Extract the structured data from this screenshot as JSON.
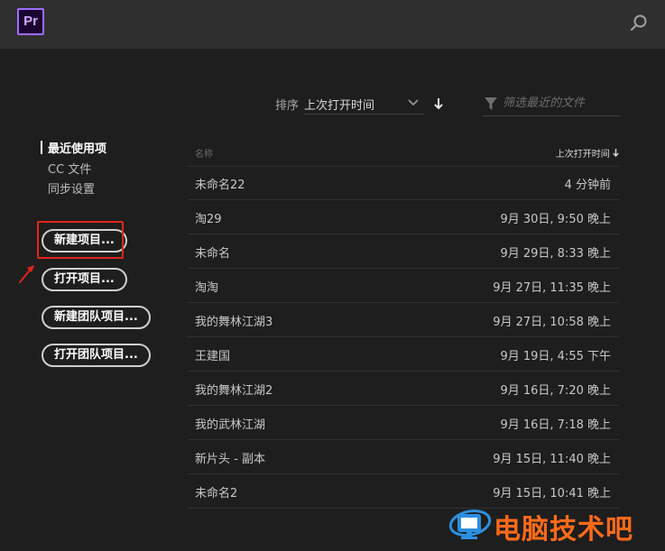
{
  "app": {
    "logo": "Pr"
  },
  "toolbar": {
    "sort_label": "排序",
    "sort_value": "上次打开时间",
    "filter_placeholder": "筛选最近的文件"
  },
  "nav": {
    "items": [
      {
        "label": "最近使用项",
        "active": true
      },
      {
        "label": "CC 文件"
      },
      {
        "label": "同步设置"
      }
    ]
  },
  "buttons": {
    "new_project": "新建项目...",
    "open_project": "打开项目...",
    "new_team_project": "新建团队项目...",
    "open_team_project": "打开团队项目..."
  },
  "table": {
    "col_name": "名称",
    "col_date": "上次打开时间",
    "rows": [
      {
        "name": "未命名22",
        "date": "4 分钟前"
      },
      {
        "name": "淘29",
        "date": "9月 30日, 9:50 晚上"
      },
      {
        "name": "未命名",
        "date": "9月 29日, 8:33 晚上"
      },
      {
        "name": "淘淘",
        "date": "9月 27日, 11:35 晚上"
      },
      {
        "name": "我的舞林江湖3",
        "date": "9月 27日, 10:58 晚上"
      },
      {
        "name": "王建国",
        "date": "9月 19日, 4:55 下午"
      },
      {
        "name": "我的舞林江湖2",
        "date": "9月 16日, 7:20 晚上"
      },
      {
        "name": "我的武林江湖",
        "date": "9月 16日, 7:18 晚上"
      },
      {
        "name": "新片头 - 副本",
        "date": "9月 15日, 11:40 晚上"
      },
      {
        "name": "未命名2",
        "date": "9月 15日, 10:41 晚上"
      }
    ]
  },
  "watermark": {
    "text": "电脑技术吧"
  },
  "colors": {
    "accent_purple": "#9f6bff",
    "highlight_red": "#e0251b",
    "watermark_orange": "#ff6a1a",
    "background": "#1e1e1e"
  }
}
